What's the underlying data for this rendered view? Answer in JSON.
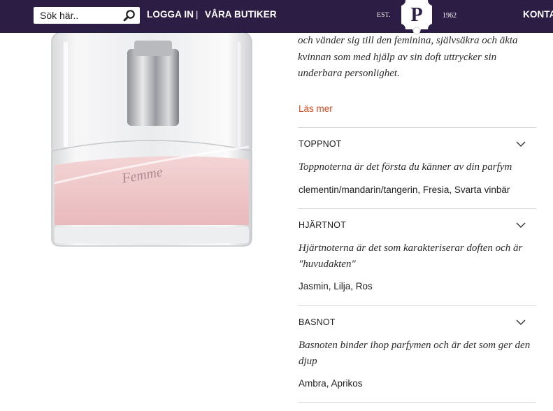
{
  "header": {
    "search_placeholder": "Sök här..",
    "login_label": "LOGGA IN",
    "separator": "|",
    "stores_label": "VÅRA BUTIKER",
    "logo_letter": "P",
    "logo_est": "EST.",
    "logo_year": "1962",
    "contact_label": "KONTA",
    "colors": {
      "bar": "#2b1d44",
      "text": "#ffffff"
    },
    "icons": {
      "search": "search-icon"
    }
  },
  "product": {
    "image_label": "Femme",
    "description": "och vänder sig till den feminina, självsäkra och äkta kvinnan som med hjälp av sin doft uttrycker sin underbara personlighet.",
    "read_more_label": "Läs mer",
    "accent_color": "#d4491f"
  },
  "notes": [
    {
      "title": "TOPPNOT",
      "description": "Toppnoterna är det första du känner av din parfym",
      "ingredients": "clementin/mandarin/tangerin, Fresia, Svarta vinbär"
    },
    {
      "title": "HJÄRTNOT",
      "description": "Hjärtnoterna är det som karakteriserar doften och är \"huvudakten\"",
      "ingredients": "Jasmin, Lilja, Ros"
    },
    {
      "title": "BASNOT",
      "description": "Basnoten binder ihop parfymen och är det som ger den djup",
      "ingredients": "Ambra, Aprikos"
    }
  ]
}
